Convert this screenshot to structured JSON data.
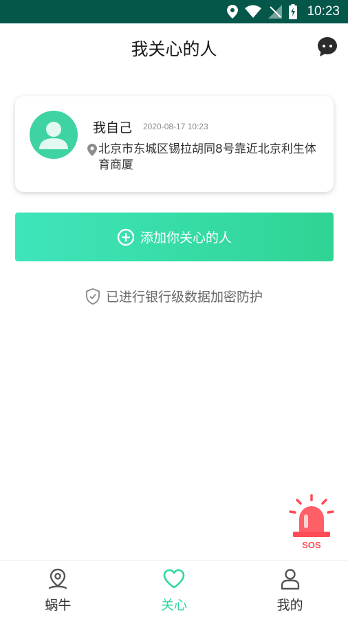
{
  "status_bar": {
    "time": "10:23"
  },
  "header": {
    "title": "我关心的人"
  },
  "card": {
    "name": "我自己",
    "time": "2020-08-17 10:23",
    "address": "北京市东城区锡拉胡同8号靠近北京利生体育商厦"
  },
  "add_button": {
    "label": "添加你关心的人"
  },
  "security": {
    "text": "已进行银行级数据加密防护"
  },
  "sos": {
    "label": "SOS"
  },
  "tabs": [
    {
      "label": "蜗牛",
      "icon": "location-pin-icon",
      "active": false
    },
    {
      "label": "关心",
      "icon": "heart-icon",
      "active": true
    },
    {
      "label": "我的",
      "icon": "user-icon",
      "active": false
    }
  ],
  "colors": {
    "status_bar": "#05574a",
    "accent": "#2ed7a0",
    "sos": "#ff4b55"
  }
}
